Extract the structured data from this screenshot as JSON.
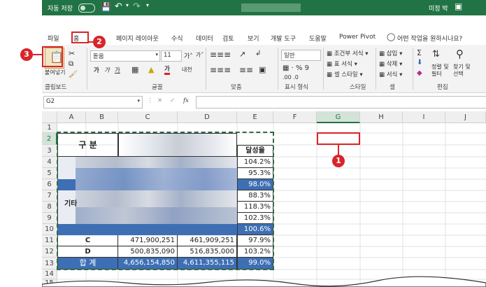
{
  "titlebar": {
    "autosave": "자동 저장",
    "toggle": "끔",
    "user": "미정 박"
  },
  "tabs": [
    {
      "label": "파일"
    },
    {
      "label": "홈"
    },
    {
      "label": "페이지 레이아웃"
    },
    {
      "label": "수식"
    },
    {
      "label": "데이터"
    },
    {
      "label": "검토"
    },
    {
      "label": "보기"
    },
    {
      "label": "개발 도구"
    },
    {
      "label": "도움말"
    },
    {
      "label": "Power Pivot"
    }
  ],
  "tell_me": "어떤 작업을 원하시나요?",
  "ribbon": {
    "paste_label": "붙여넣기",
    "font_name": "돋움",
    "font_size": "11",
    "number_format": "일반",
    "conditional_format": "조건부 서식",
    "table_format": "표 서식",
    "cell_style": "셀 스타일",
    "insert": "삽입",
    "delete": "삭제",
    "format": "서식",
    "sort_filter": "정렬 및 필터",
    "find_select": "찾기 및 선택",
    "groups": {
      "clipboard": "클립보드",
      "font": "글꼴",
      "alignment": "맞춤",
      "number": "표시 형식",
      "styles": "스타일",
      "cells": "셀",
      "editing": "편집"
    }
  },
  "formula_bar": {
    "name_box": "G2",
    "fx": "fx"
  },
  "columns": [
    "A",
    "B",
    "C",
    "D",
    "E",
    "F",
    "G",
    "H",
    "I",
    "J"
  ],
  "rows": [
    "1",
    "2",
    "3",
    "4",
    "5",
    "6",
    "7",
    "8",
    "9",
    "10",
    "11",
    "12",
    "13",
    "14",
    "15"
  ],
  "table": {
    "header_label": "구 분",
    "rate_header": "달성율",
    "rates": [
      "104.2%",
      "95.3%",
      "98.0%",
      "88.3%",
      "118.3%",
      "102.3%",
      "100.6%"
    ],
    "other_label": "기타",
    "row_c": {
      "label": "C",
      "col_c": "471,900,251",
      "col_d": "461,909,251",
      "rate": "97.9%"
    },
    "row_d": {
      "label": "D",
      "col_c": "500,835,090",
      "col_d": "516,835,000",
      "rate": "103.2%"
    },
    "total": {
      "label": "합  계",
      "col_c": "4,656,154,850",
      "col_d": "4,611,355,115",
      "rate": "99.0%"
    }
  },
  "callouts": [
    "1",
    "2",
    "3"
  ],
  "colors": {
    "excel_green": "#217346",
    "accent_blue": "#3e6fb4",
    "badge_red": "#d9242b"
  }
}
